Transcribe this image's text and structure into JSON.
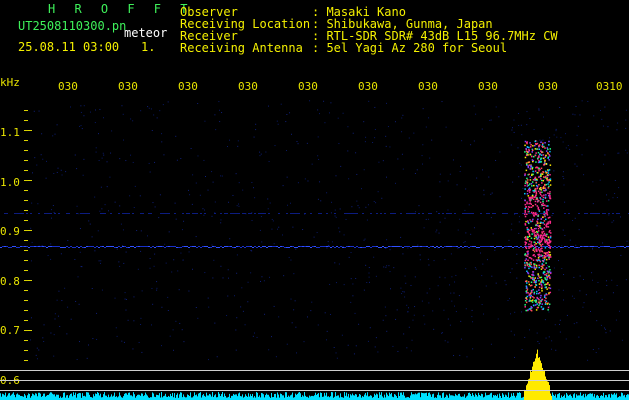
{
  "header": {
    "program": "H R O F F T",
    "filename": "UT2508110300.pn",
    "kind": "meteor",
    "datetime": "25.08.11 03:00",
    "index": "1.",
    "observer_label": "Observer",
    "observer_value": ": Masaki Kano",
    "location_label": "Receiving Location",
    "location_value": ": Shibukawa, Gunma, Japan",
    "receiver_label": "Receiver",
    "receiver_value": ": RTL-SDR SDR# 43dB L15 96.7MHz CW",
    "antenna_label": "Receiving Antenna",
    "antenna_value": ": 5el Yagi Az 280 for Seoul"
  },
  "axis": {
    "unit": "kHz",
    "time_ticks": [
      "030",
      "030",
      "030",
      "030",
      "030",
      "030",
      "030",
      "030",
      "030",
      "0310"
    ],
    "freq_labels": [
      "1.1",
      "1.0",
      "0.9",
      "0.8",
      "0.7",
      "0.6"
    ]
  },
  "colors": {
    "background": "#000000",
    "label_green": "#3ef05a",
    "label_yellow": "#f4f000",
    "trace_cyan": "#00e0ff",
    "echo_magenta": "#ff2a8c",
    "echo_yellow": "#ffea00"
  }
}
